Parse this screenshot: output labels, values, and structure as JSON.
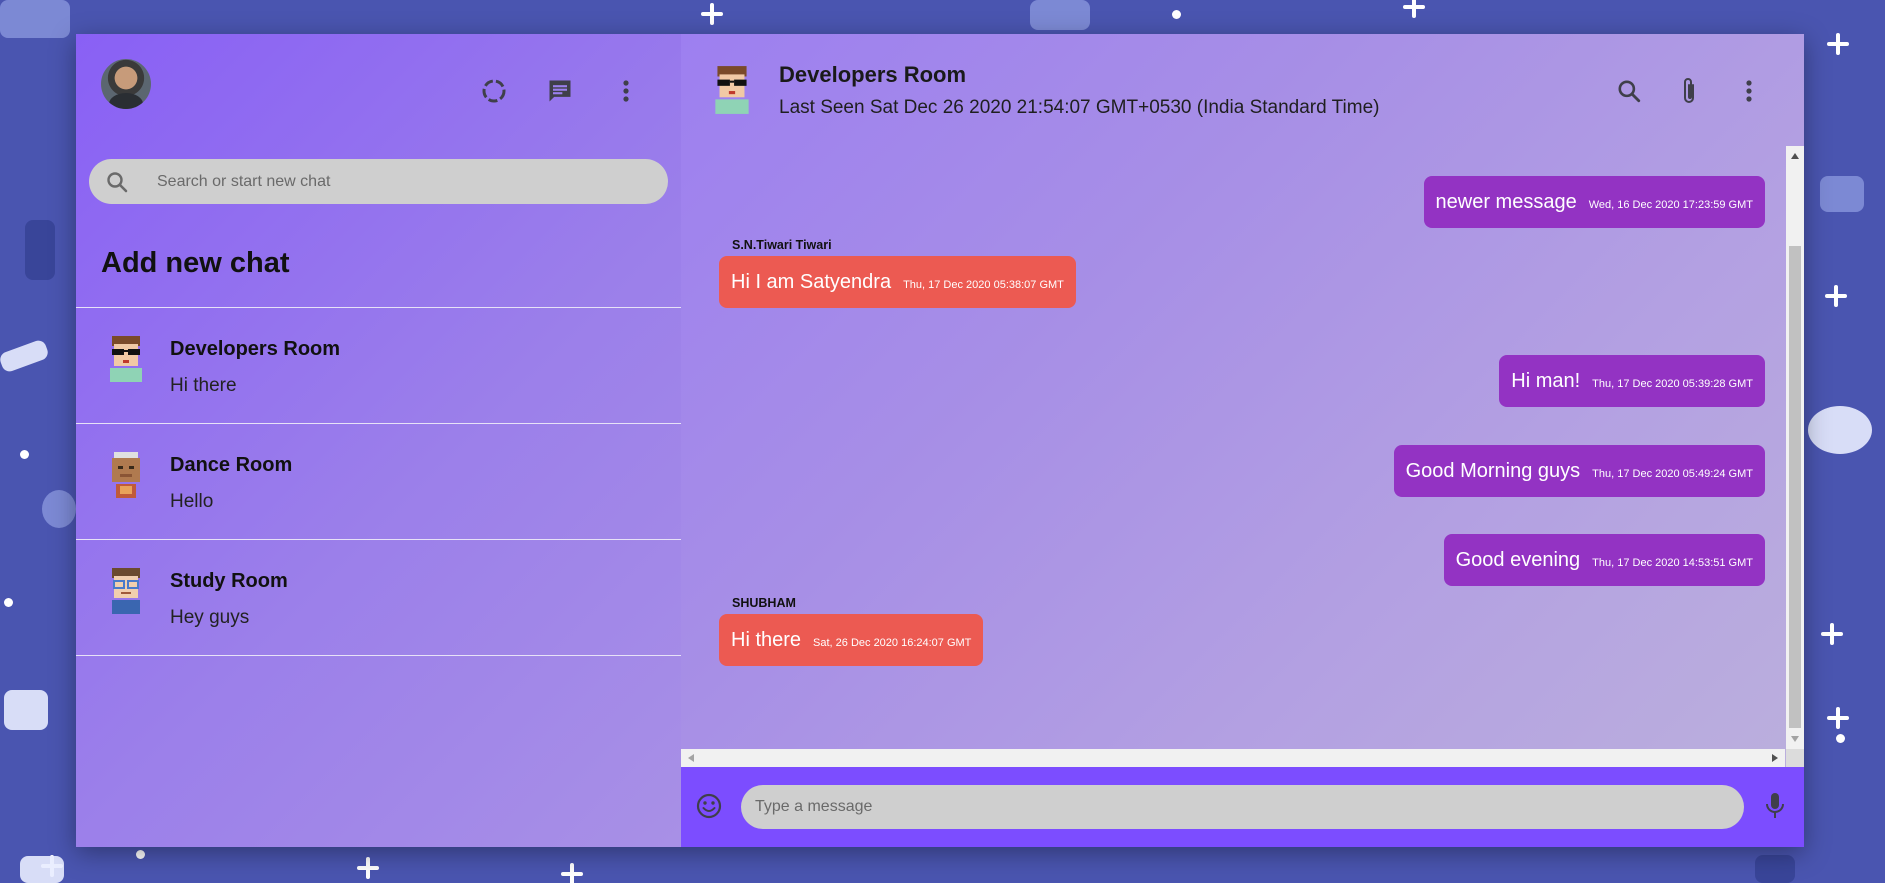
{
  "sidebar": {
    "search_placeholder": "Search or start new chat",
    "add_new_chat": "Add new chat",
    "chats": [
      {
        "name": "Developers Room",
        "last_message": "Hi there"
      },
      {
        "name": "Dance Room",
        "last_message": "Hello"
      },
      {
        "name": "Study Room",
        "last_message": "Hey guys"
      }
    ]
  },
  "chat": {
    "room_name": "Developers Room",
    "last_seen": "Last Seen Sat Dec 26 2020 21:54:07 GMT+0530 (India Standard Time)",
    "messages": [
      {
        "sender": "",
        "text": "newer message",
        "timestamp": "Wed, 16 Dec 2020 17:23:59 GMT",
        "sent": true
      },
      {
        "sender": "S.N.Tiwari Tiwari",
        "text": "Hi I am Satyendra",
        "timestamp": "Thu, 17 Dec 2020 05:38:07 GMT",
        "sent": false
      },
      {
        "sender": "",
        "text": "Hi man!",
        "timestamp": "Thu, 17 Dec 2020 05:39:28 GMT",
        "sent": true
      },
      {
        "sender": "",
        "text": "Good Morning guys",
        "timestamp": "Thu, 17 Dec 2020 05:49:24 GMT",
        "sent": true
      },
      {
        "sender": "",
        "text": "Good evening",
        "timestamp": "Thu, 17 Dec 2020 14:53:51 GMT",
        "sent": true
      },
      {
        "sender": "SHUBHAM",
        "text": "Hi there",
        "timestamp": "Sat, 26 Dec 2020 16:24:07 GMT",
        "sent": false
      }
    ],
    "input_placeholder": "Type a message"
  },
  "icons": {
    "status": "status-ring-icon",
    "new_chat": "chat-bubble-icon",
    "menu": "more-vertical-icon",
    "search": "search-icon",
    "attach": "paperclip-icon",
    "emoji": "emoji-icon",
    "mic": "mic-icon"
  },
  "colors": {
    "accent": "#7c4dff",
    "sent_bubble": "#9333c3",
    "received_bubble": "#ec5a52"
  }
}
